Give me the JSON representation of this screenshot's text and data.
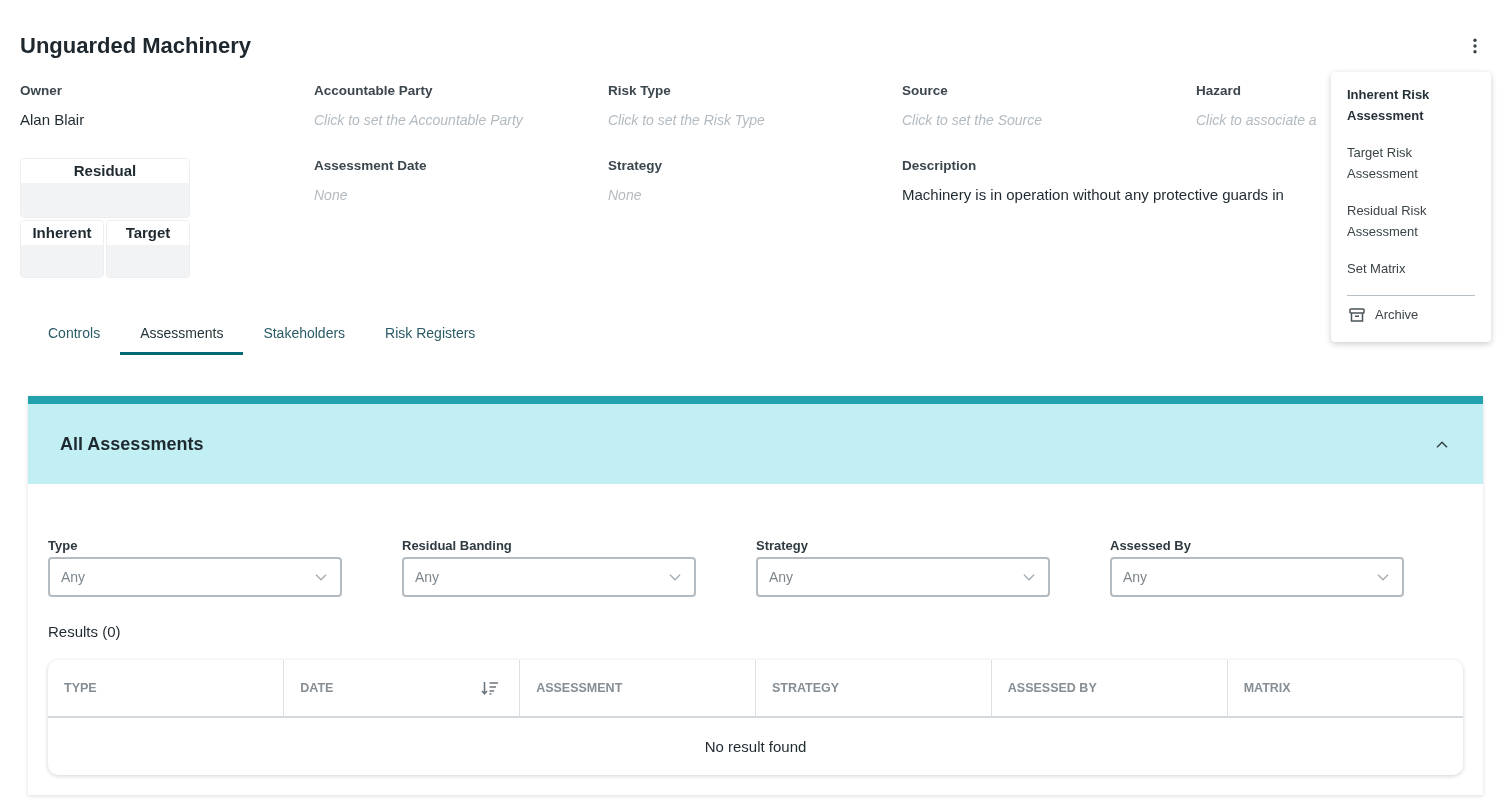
{
  "title": "Unguarded Machinery",
  "details": {
    "rows": [
      [
        {
          "kind": "field",
          "label": "Owner",
          "value": "Alan Blair"
        },
        {
          "kind": "field",
          "label": "Accountable Party",
          "placeholder": "Click to set the Accountable Party"
        },
        {
          "kind": "field",
          "label": "Risk Type",
          "placeholder": "Click to set the Risk Type"
        },
        {
          "kind": "field",
          "label": "Source",
          "placeholder": "Click to set the Source"
        },
        {
          "kind": "field",
          "label": "Hazard",
          "placeholder": "Click to associate a"
        }
      ],
      [
        {
          "kind": "matrix",
          "levels": [
            {
              "label": "Residual"
            },
            {
              "label": "Inherent"
            },
            {
              "label": "Target"
            }
          ]
        },
        {
          "kind": "field",
          "label": "Assessment Date",
          "placeholder": "None"
        },
        {
          "kind": "field",
          "label": "Strategy",
          "placeholder": "None"
        },
        {
          "kind": "field",
          "label": "Description",
          "value": "Machinery is in operation without any protective guards in"
        }
      ]
    ]
  },
  "tabs": [
    {
      "label": "Controls",
      "selected": false
    },
    {
      "label": "Assessments",
      "selected": true
    },
    {
      "label": "Stakeholders",
      "selected": false
    },
    {
      "label": "Risk Registers",
      "selected": false
    }
  ],
  "assessments_panel": {
    "title": "All Assessments",
    "expanded": true,
    "filters": [
      {
        "label": "Type",
        "placeholder": "Any"
      },
      {
        "label": "Residual Banding",
        "placeholder": "Any"
      },
      {
        "label": "Strategy",
        "placeholder": "Any"
      },
      {
        "label": "Assessed By",
        "placeholder": "Any"
      }
    ],
    "results_label": "Results (0)",
    "table": {
      "columns": [
        {
          "label": "TYPE",
          "sorted": false
        },
        {
          "label": "DATE",
          "sorted": true
        },
        {
          "label": "ASSESSMENT",
          "sorted": false
        },
        {
          "label": "STRATEGY",
          "sorted": false
        },
        {
          "label": "ASSESSED BY",
          "sorted": false
        },
        {
          "label": "MATRIX",
          "sorted": false
        }
      ],
      "empty_message": "No result found"
    }
  },
  "menu": {
    "items": [
      {
        "label": "Inherent Risk Assessment",
        "kind": "text",
        "selected": true
      },
      {
        "label": "Target Risk Assessment",
        "kind": "text",
        "selected": false
      },
      {
        "label": "Residual Risk Assessment",
        "kind": "text",
        "selected": false
      },
      {
        "label": "Set Matrix",
        "kind": "text",
        "selected": false
      },
      {
        "label": "Archive",
        "kind": "archive",
        "selected": false
      }
    ]
  }
}
